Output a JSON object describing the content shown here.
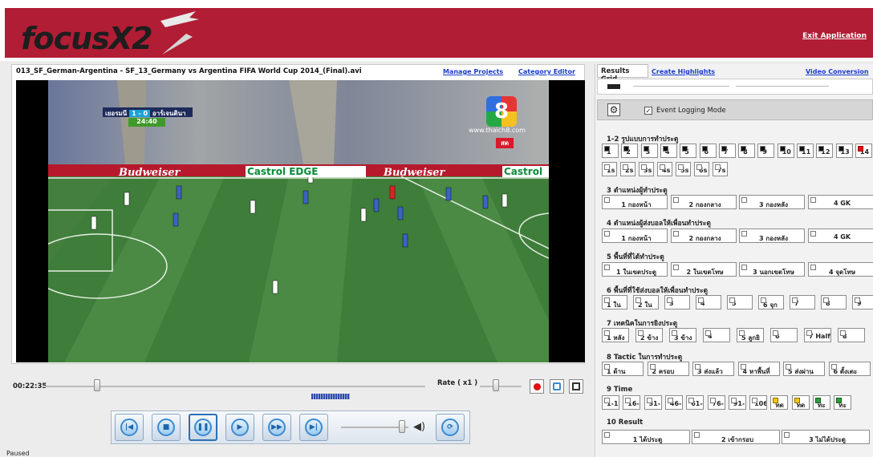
{
  "app": {
    "logo": "focusX2",
    "exit": "Exit Application",
    "status": "Paused"
  },
  "left": {
    "file_title": "013_SF_German-Argentina - SF_13_Germany vs Argentina FIFA World Cup 2014_(Final).avi",
    "manage_projects": "Manage Projects",
    "category_editor": "Category Editor",
    "scoreboard": {
      "team_home": "เยอรมนี",
      "score": "1 - 0",
      "team_away": "อาร์เจนตินา",
      "clock": "24:40"
    },
    "channel": {
      "number": "8",
      "site": "www.thaich8.com",
      "live": "สด"
    },
    "ads": [
      "Budweiser",
      "Castrol EDGE",
      "Budweiser",
      "Castrol"
    ],
    "time": "00:22:35",
    "rate": "Rate ( x1 )"
  },
  "right": {
    "tab_results": "Results Grid",
    "tab_highlights": "Create Highlights",
    "tab_conversion": "Video Conversion",
    "event_logging": "Event Logging Mode",
    "sections": [
      {
        "title": "1-2 รูปแบบการทำประตู",
        "rows": [
          [
            "1",
            "2",
            "3",
            "4",
            "5",
            "6",
            "7",
            "8",
            "9",
            "10",
            "11",
            "12",
            "13",
            "14"
          ],
          [
            "1s",
            "2s",
            "3s",
            "4s",
            "5s",
            "6s",
            "7s"
          ]
        ]
      },
      {
        "title": "3 ตำแหน่งผู้ทำประตู",
        "rows": [
          [
            "1 กองหน้า",
            "2 กองกลาง",
            "3 กองหลัง",
            "4 GK"
          ]
        ]
      },
      {
        "title": "4 ตำแหน่งผู้ส่งบอลให้เพื่อนทำประตู",
        "rows": [
          [
            "1 กองหน้า",
            "2 กองกลาง",
            "3 กองหลัง",
            "4 GK"
          ]
        ]
      },
      {
        "title": "5 พื้นที่ที่ได้ทำประตู",
        "rows": [
          [
            "1 ในเขตประตู",
            "2 ในเขตโทษ",
            "3 นอกเขตโทษ",
            "4 จุดโทษ"
          ]
        ]
      },
      {
        "title": "6 พื้นที่ที่ใช้ส่งบอลให้เพื่อนทำประตู",
        "rows": [
          [
            "1 ใน",
            "2 ใน",
            "3",
            "4",
            "5",
            "6 จุก",
            "7",
            "8",
            "9"
          ]
        ]
      },
      {
        "title": "7 เทคนิคในการยิงประตู",
        "rows": [
          [
            "1 หลัง",
            "2 ข้าง",
            "3 ข้าง",
            "4",
            "5 ลูกยิ",
            "6",
            "7 Half",
            "8"
          ]
        ]
      },
      {
        "title": "8 Tactic ในการทำประตู",
        "rows": [
          [
            "1 ด้าน",
            "2 ครอบ",
            "3 ส่งแล้ว",
            "4 หาพื้นที่",
            "5 ส่งผ่าน",
            "6 ตั้งเตะ"
          ]
        ]
      },
      {
        "title": "9 Time",
        "rows": [
          [
            "1-1",
            "16-",
            "31-",
            "46-",
            "61-",
            "76-",
            "91-",
            "106",
            "ทด",
            "ทด",
            "ทะ",
            "ทะ"
          ]
        ]
      },
      {
        "title": "10 Result",
        "rows": [
          [
            "1 ได้ประตู",
            "2 เข้ากรอบ",
            "3 ไม่ได้ประตู"
          ]
        ]
      }
    ]
  },
  "colors": {
    "header": "#b11d34",
    "pitch": "#3e7d3a",
    "link": "#1a3cc8"
  }
}
